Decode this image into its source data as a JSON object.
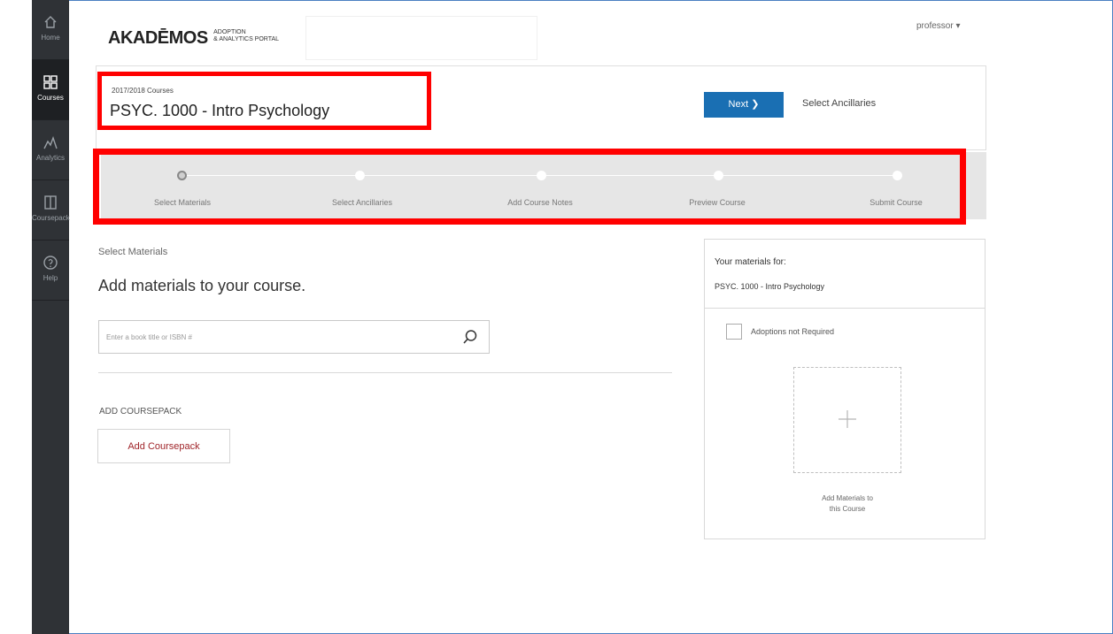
{
  "app": {
    "logo_main": "AKADĒMOS",
    "logo_sub_line1": "ADOPTION",
    "logo_sub_line2": "& ANALYTICS PORTAL"
  },
  "header": {
    "user_menu": "professor ▾"
  },
  "sidebar": {
    "items": [
      {
        "label": "Home",
        "icon": "home-icon"
      },
      {
        "label": "Courses",
        "icon": "grid-icon",
        "active": true
      },
      {
        "label": "Analytics",
        "icon": "chart-icon"
      },
      {
        "label": "Coursepack",
        "icon": "book-icon"
      },
      {
        "label": "Help",
        "icon": "help-icon"
      }
    ]
  },
  "course": {
    "term": "2017/2018 Courses",
    "title": "PSYC. 1000 - Intro Psychology",
    "next_label": "Next ❯",
    "next_step": "Select Ancillaries"
  },
  "stepper": {
    "steps": [
      {
        "label": "Select Materials",
        "current": true
      },
      {
        "label": "Select Ancillaries"
      },
      {
        "label": "Add Course Notes"
      },
      {
        "label": "Preview Course"
      },
      {
        "label": "Submit Course"
      }
    ]
  },
  "main": {
    "section_label": "Select Materials",
    "section_title": "Add materials to your course.",
    "search_placeholder": "Enter a book title or ISBN #",
    "coursepack_label": "ADD COURSEPACK",
    "coursepack_button": "Add Coursepack"
  },
  "materials_panel": {
    "heading": "Your materials for:",
    "course": "PSYC. 1000 - Intro Psychology",
    "checkbox_label": "Adoptions not Required",
    "add_label_line1": "Add Materials to",
    "add_label_line2": "this Course"
  },
  "colors": {
    "sidebar_bg": "#2f3236",
    "accent": "#1a6fb3",
    "highlight": "#ff0000",
    "coursepack_text": "#a0252a"
  }
}
